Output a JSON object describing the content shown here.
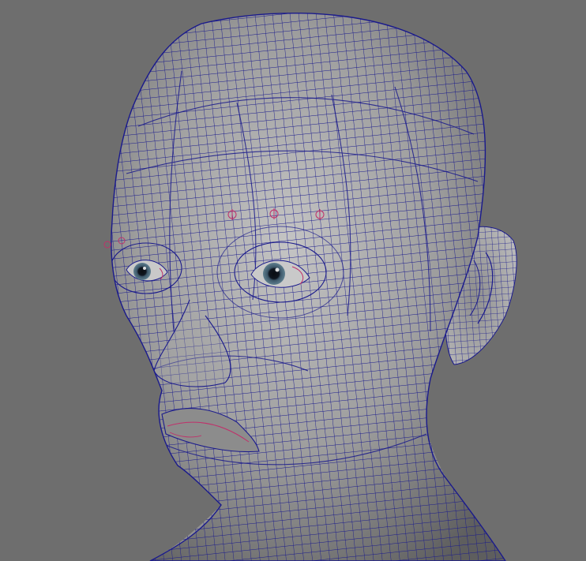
{
  "viewport": {
    "background": "#6e6e6e",
    "wireframe_color": "#1a1a8c",
    "selection_color": "#c0306a",
    "skin_light": "#b9b9b9",
    "skin_dark": "#5f5f5f"
  },
  "model": {
    "type": "polygon-head-mesh",
    "display_mode": "wireframe-on-shaded"
  },
  "icons": {
    "joint_marker": "joint-locator-icon"
  }
}
